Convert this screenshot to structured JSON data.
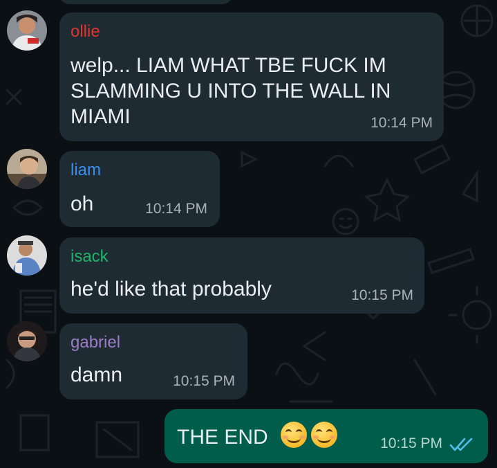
{
  "messages": [
    {
      "sender": "ollie",
      "sender_color": "#e2352c",
      "text": "welp... LIAM WHAT TBE FUCK IM SLAMMING U INTO THE WALL IN MIAMI",
      "time": "10:14 PM"
    },
    {
      "sender": "liam",
      "sender_color": "#3a8ff5",
      "text": "oh",
      "time": "10:14 PM"
    },
    {
      "sender": "isack",
      "sender_color": "#21b36a",
      "text": "he'd like that probably",
      "time": "10:15 PM"
    },
    {
      "sender": "gabriel",
      "sender_color": "#9b7cc8",
      "text": "damn",
      "time": "10:15 PM"
    }
  ],
  "outgoing": {
    "text": "THE END",
    "emoji_count": 2,
    "emoji": "smiling-face-icon",
    "time": "10:15 PM",
    "status": "read",
    "status_icon": "double-check-icon",
    "status_color": "#53bdeb"
  }
}
